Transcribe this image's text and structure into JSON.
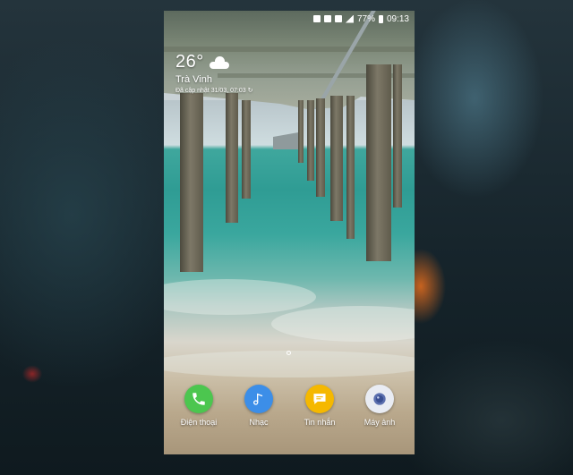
{
  "status_bar": {
    "battery": "77%",
    "time": "09:13"
  },
  "weather": {
    "temperature": "26°",
    "city": "Trà Vinh",
    "updated": "Đã cập nhật 31/03, 07:03",
    "icon": "cloud-icon"
  },
  "dock": {
    "apps": [
      {
        "label": "Điện thoại",
        "icon": "phone-icon",
        "color": "#4cc64f"
      },
      {
        "label": "Nhạc",
        "icon": "music-note-icon",
        "color": "#3c8ee8"
      },
      {
        "label": "Tin nhắn",
        "icon": "message-icon",
        "color": "#f5b800"
      },
      {
        "label": "Máy ảnh",
        "icon": "camera-icon",
        "color": "#e9ecf3"
      }
    ]
  }
}
